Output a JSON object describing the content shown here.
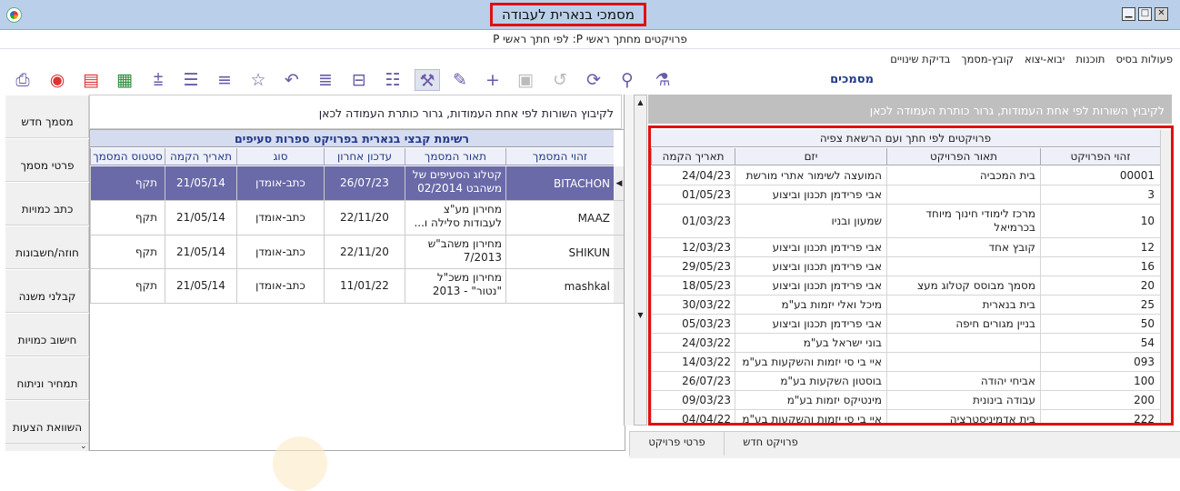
{
  "window": {
    "title": "מסמכי בנארית לעבודה",
    "subtitle": "פרויקטים מחתך ראשי P: לפי חתך ראשי P",
    "controls": [
      "minimize-icon",
      "maximize-icon",
      "close-icon"
    ]
  },
  "menu": [
    "פעולות בסיס",
    "תוכנות",
    "יבוא-יצוא",
    "קובץ-מסמך",
    "בדיקת שינויים"
  ],
  "section_title": "מסמכים",
  "toolbar": [
    {
      "icon": "printer-icon"
    },
    {
      "icon": "preview-icon"
    },
    {
      "icon": "pdf-icon"
    },
    {
      "icon": "excel-icon"
    },
    {
      "icon": "add-lines-icon"
    },
    {
      "icon": "lines-icon"
    },
    {
      "icon": "insert-lines-icon"
    },
    {
      "icon": "star-icon"
    },
    {
      "icon": "undo-star-icon"
    },
    {
      "icon": "list-icon"
    },
    {
      "icon": "indent-icon"
    },
    {
      "icon": "checklist-icon"
    },
    {
      "icon": "tools-icon"
    },
    {
      "icon": "edit-icon"
    },
    {
      "icon": "add-icon"
    },
    {
      "icon": "save-icon"
    },
    {
      "icon": "undo-icon"
    },
    {
      "icon": "refresh-icon"
    },
    {
      "icon": "search-icon"
    },
    {
      "icon": "filter-icon"
    }
  ],
  "left_nav": [
    "מסמך חדש",
    "פרטי מסמך",
    "כתב כמויות",
    "חוזה/חשבונות",
    "קבלני משנה",
    "חישוב כמויות",
    "תמחיר וניתוח",
    "השוואת הצעות"
  ],
  "left_panel": {
    "group_hint": "לקיבוץ השורות לפי אחת העמודות, גרור כותרת העמודה לכאן",
    "grid_title": "רשימת קבצי בנארית בפרויקט ספרות סעיפים",
    "columns": [
      "זהוי המסמך",
      "תאור המסמך",
      "עדכון אחרון",
      "סוג",
      "תאריך הקמה",
      "סטטוס המסמך"
    ],
    "rows": [
      {
        "code": "BITACHON",
        "desc": "קטלוג הסעיפים של משהבט 02/2014",
        "updated": "26/07/23",
        "type": "כתב-אומדן",
        "created": "21/05/14",
        "status": "תקף"
      },
      {
        "code": "MAAZ",
        "desc": "מחירון מע\"צ לעבודות סלילה ו...",
        "updated": "22/11/20",
        "type": "כתב-אומדן",
        "created": "21/05/14",
        "status": "תקף"
      },
      {
        "code": "SHIKUN",
        "desc": "מחירון משהב\"ש 7/2013",
        "updated": "22/11/20",
        "type": "כתב-אומדן",
        "created": "21/05/14",
        "status": "תקף"
      },
      {
        "code": "mashkal",
        "desc": "מחירון משכ\"ל \"נטור\" - 2013",
        "updated": "11/01/22",
        "type": "כתב-אומדן",
        "created": "21/05/14",
        "status": "תקף"
      }
    ]
  },
  "right_panel": {
    "group_hint": "לקיבוץ השורות לפי אחת העמודות, גרור כותרת העמודה לכאן",
    "grid_title": "פרויקטים לפי חתך ועם הרשאת צפיה",
    "columns": [
      "זהוי הפרויקט",
      "תאור הפרויקט",
      "יזם",
      "תאריך הקמה"
    ],
    "rows": [
      {
        "code": "00001",
        "desc": "בית המכביה",
        "entrepreneur": "המועצה לשימור אתרי מורשת",
        "created": "24/04/23"
      },
      {
        "code": "3",
        "desc": "",
        "entrepreneur": "אבי פרידמן תכנון וביצוע",
        "created": "01/05/23"
      },
      {
        "code": "10",
        "desc": "מרכז לימודי חינוך מיוחד בכרמיאל",
        "entrepreneur": "שמעון ובניו",
        "created": "01/03/23"
      },
      {
        "code": "12",
        "desc": "קובץ אחד",
        "entrepreneur": "אבי פרידמן תכנון וביצוע",
        "created": "12/03/23"
      },
      {
        "code": "16",
        "desc": "",
        "entrepreneur": "אבי פרידמן תכנון וביצוע",
        "created": "29/05/23"
      },
      {
        "code": "20",
        "desc": "מסמך מבוסס קטלוג מעצ",
        "entrepreneur": "אבי פרידמן תכנון וביצוע",
        "created": "18/05/23"
      },
      {
        "code": "25",
        "desc": "בית בנארית",
        "entrepreneur": "מיכל ואלי יזמות בע\"מ",
        "created": "30/03/22"
      },
      {
        "code": "50",
        "desc": "בניין מגורים חיפה",
        "entrepreneur": "אבי פרידמן תכנון וביצוע",
        "created": "05/03/23"
      },
      {
        "code": "54",
        "desc": "",
        "entrepreneur": "בוני ישראל בע\"מ",
        "created": "24/03/22"
      },
      {
        "code": "093",
        "desc": "",
        "entrepreneur": "איי בי סי יזמות והשקעות בע\"מ",
        "created": "14/03/22"
      },
      {
        "code": "100",
        "desc": "אביחי יהודה",
        "entrepreneur": "בוסטון השקעות בע\"מ",
        "created": "26/07/23"
      },
      {
        "code": "200",
        "desc": "עבודה בינונית",
        "entrepreneur": "מינטיקס יזמות בע\"מ",
        "created": "09/03/23"
      },
      {
        "code": "222",
        "desc": "בית אדמיניסטרציה",
        "entrepreneur": "איי בי סי יזמות והשקעות בע\"מ",
        "created": "04/04/22"
      }
    ]
  },
  "bottom_tabs": [
    "פרויקט חדש",
    "פרטי פרויקט"
  ]
}
